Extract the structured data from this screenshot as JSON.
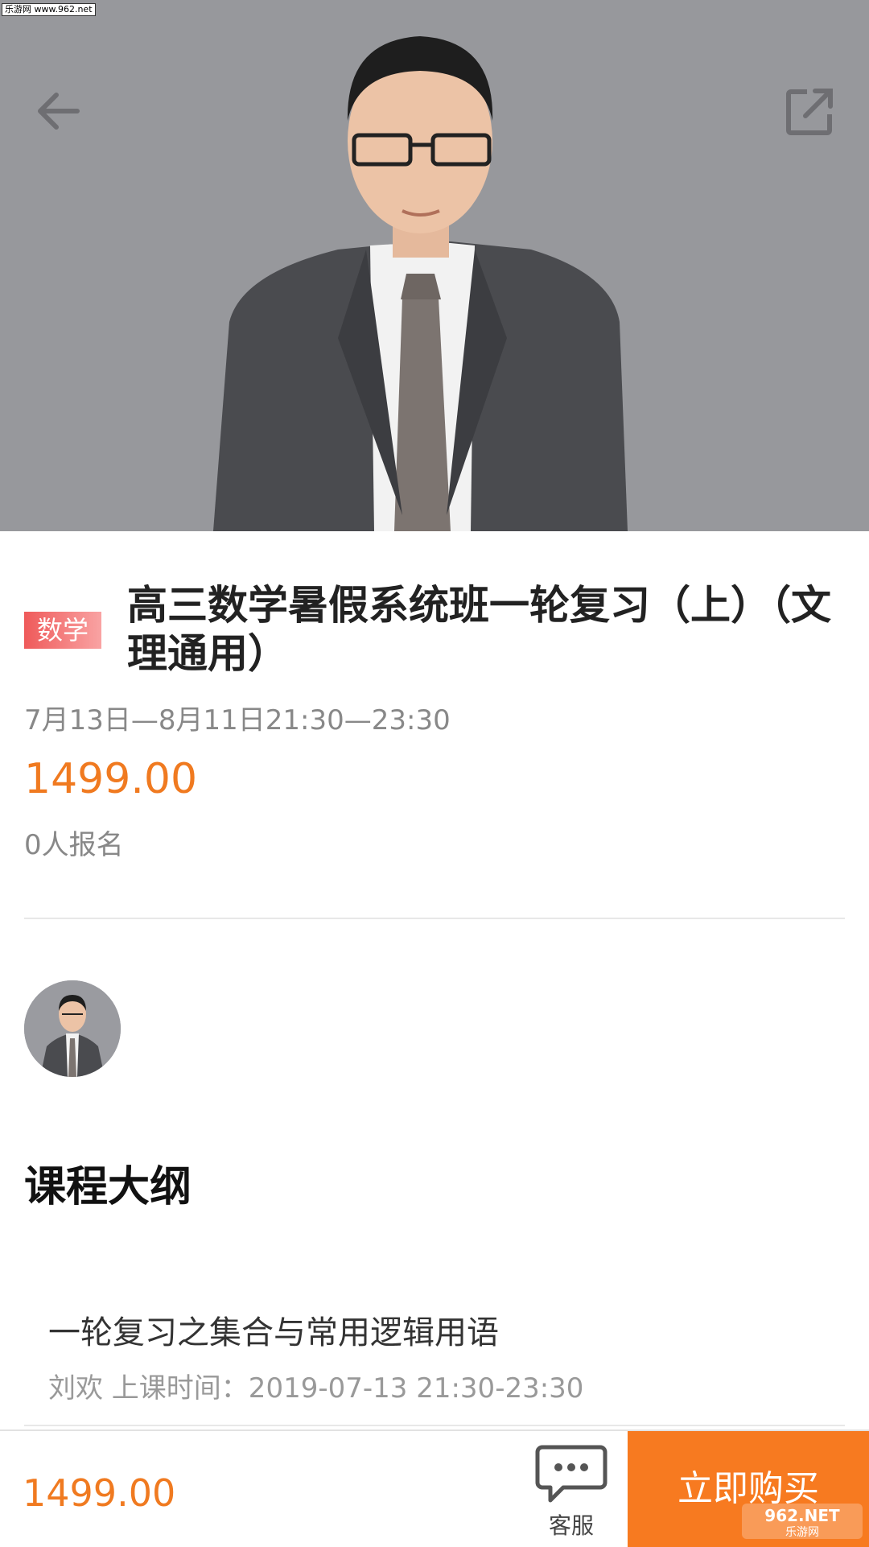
{
  "watermark_top": "乐游网 www.962.net",
  "hero": {
    "back_icon": "arrow-left-icon",
    "share_icon": "external-share-icon",
    "background": "#97989c"
  },
  "course": {
    "subject_tag": "数学",
    "title": "高三数学暑假系统班一轮复习（上）（文理通用）",
    "date_range": "7月13日—8月11日21:30—23:30",
    "price": "1499.00",
    "enrollment": "0人报名"
  },
  "outline": {
    "heading": "课程大纲",
    "lessons": [
      {
        "title": "一轮复习之集合与常用逻辑用语",
        "meta": "刘欢  上课时间：2019-07-13 21:30-23:30"
      }
    ]
  },
  "bottom_bar": {
    "price": "1499.00",
    "service_label": "客服",
    "service_icon": "chat-bubble-icon",
    "buy_label": "立即购买"
  },
  "watermark_bottom": {
    "line1": "962.NET",
    "line2": "乐游网"
  },
  "colors": {
    "accent": "#f77a20",
    "price": "#f07a20",
    "tag": "#ef5a5a"
  }
}
